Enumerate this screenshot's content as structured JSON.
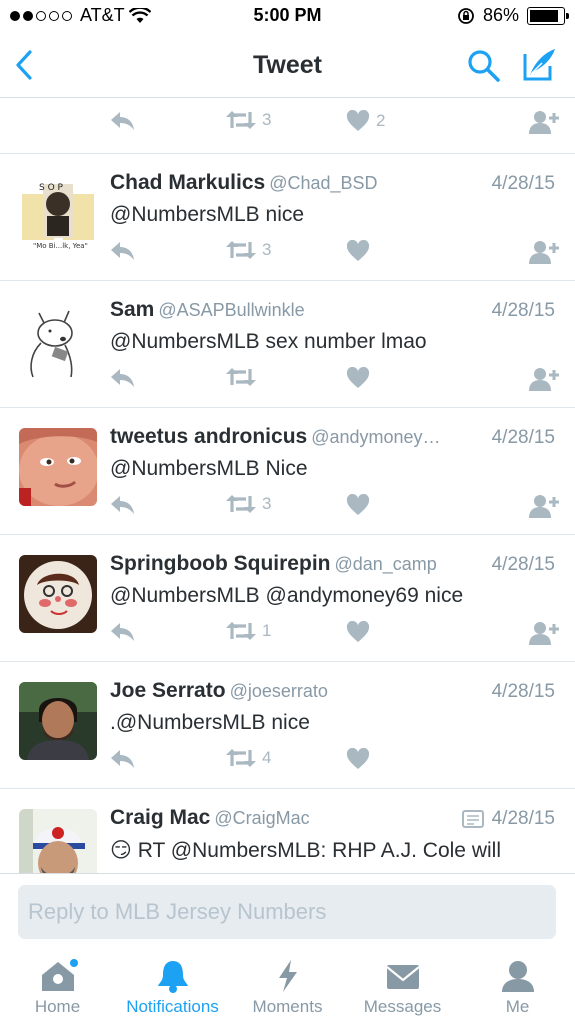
{
  "status_bar": {
    "carrier": "AT&T",
    "time": "5:00 PM",
    "battery": "86%",
    "battery_level": 0.86
  },
  "nav": {
    "title": "Tweet"
  },
  "top_actions": {
    "retweets": "3",
    "likes": "2"
  },
  "tweets": [
    {
      "name": "Chad Markulics",
      "handle": "@Chad_BSD",
      "date": "4/28/15",
      "text": "@NumbersMLB nice",
      "retweets": "3",
      "likes": "",
      "avatar": "poster"
    },
    {
      "name": "Sam",
      "handle": "@ASAPBullwinkle",
      "date": "4/28/15",
      "text": "@NumbersMLB sex number lmao",
      "retweets": "",
      "likes": "",
      "avatar": "sketch"
    },
    {
      "name": "tweetus andronicus",
      "handle": "@andymoney…",
      "date": "4/28/15",
      "text": "@NumbersMLB Nice",
      "retweets": "3",
      "likes": "",
      "avatar": "face-closeup"
    },
    {
      "name": "Springboob Squirepin",
      "handle": "@dan_camp",
      "date": "4/28/15",
      "text": "@NumbersMLB @andymoney69 nice",
      "retweets": "1",
      "likes": "",
      "avatar": "cake"
    },
    {
      "name": "Joe Serrato",
      "handle": "@joeserrato",
      "date": "4/28/15",
      "text": ".@NumbersMLB nice",
      "retweets": "4",
      "likes": "",
      "avatar": "photo-man"
    },
    {
      "name": "Craig Mac",
      "handle": "@CraigMac",
      "date": "4/28/15",
      "text": "😏 RT @NumbersMLB: RHP A.J. Cole will",
      "retweets": "",
      "likes": "",
      "avatar": "cap-man"
    }
  ],
  "reply": {
    "placeholder": "Reply to MLB Jersey Numbers"
  },
  "tabs": [
    {
      "label": "Home",
      "icon": "home-icon"
    },
    {
      "label": "Notifications",
      "icon": "bell-icon"
    },
    {
      "label": "Moments",
      "icon": "lightning-icon"
    },
    {
      "label": "Messages",
      "icon": "envelope-icon"
    },
    {
      "label": "Me",
      "icon": "person-icon"
    }
  ],
  "colors": {
    "accent": "#1da1f2",
    "icon_grey": "#aab8c2",
    "text_grey": "#8899a6"
  }
}
